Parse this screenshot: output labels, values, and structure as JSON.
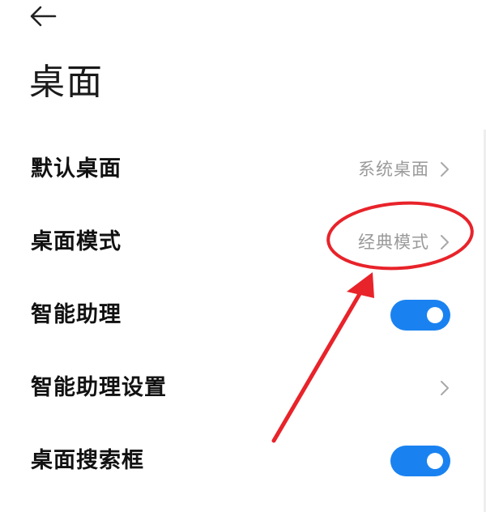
{
  "header": {
    "back_icon": "arrow-left-icon"
  },
  "page": {
    "title": "桌面"
  },
  "settings": {
    "default_desktop": {
      "label": "默认桌面",
      "value": "系统桌面",
      "icon": "chevron-right-icon"
    },
    "desktop_mode": {
      "label": "桌面模式",
      "value": "经典模式",
      "icon": "chevron-right-icon"
    },
    "smart_assistant": {
      "label": "智能助理",
      "toggle_on": true
    },
    "smart_assistant_settings": {
      "label": "智能助理设置",
      "icon": "chevron-right-icon"
    },
    "desktop_search_bar": {
      "label": "桌面搜索框",
      "toggle_on": true
    }
  },
  "colors": {
    "toggle_on": "#1a82f0",
    "annotation": "#e8232a",
    "value_text": "#9a9a9a"
  }
}
